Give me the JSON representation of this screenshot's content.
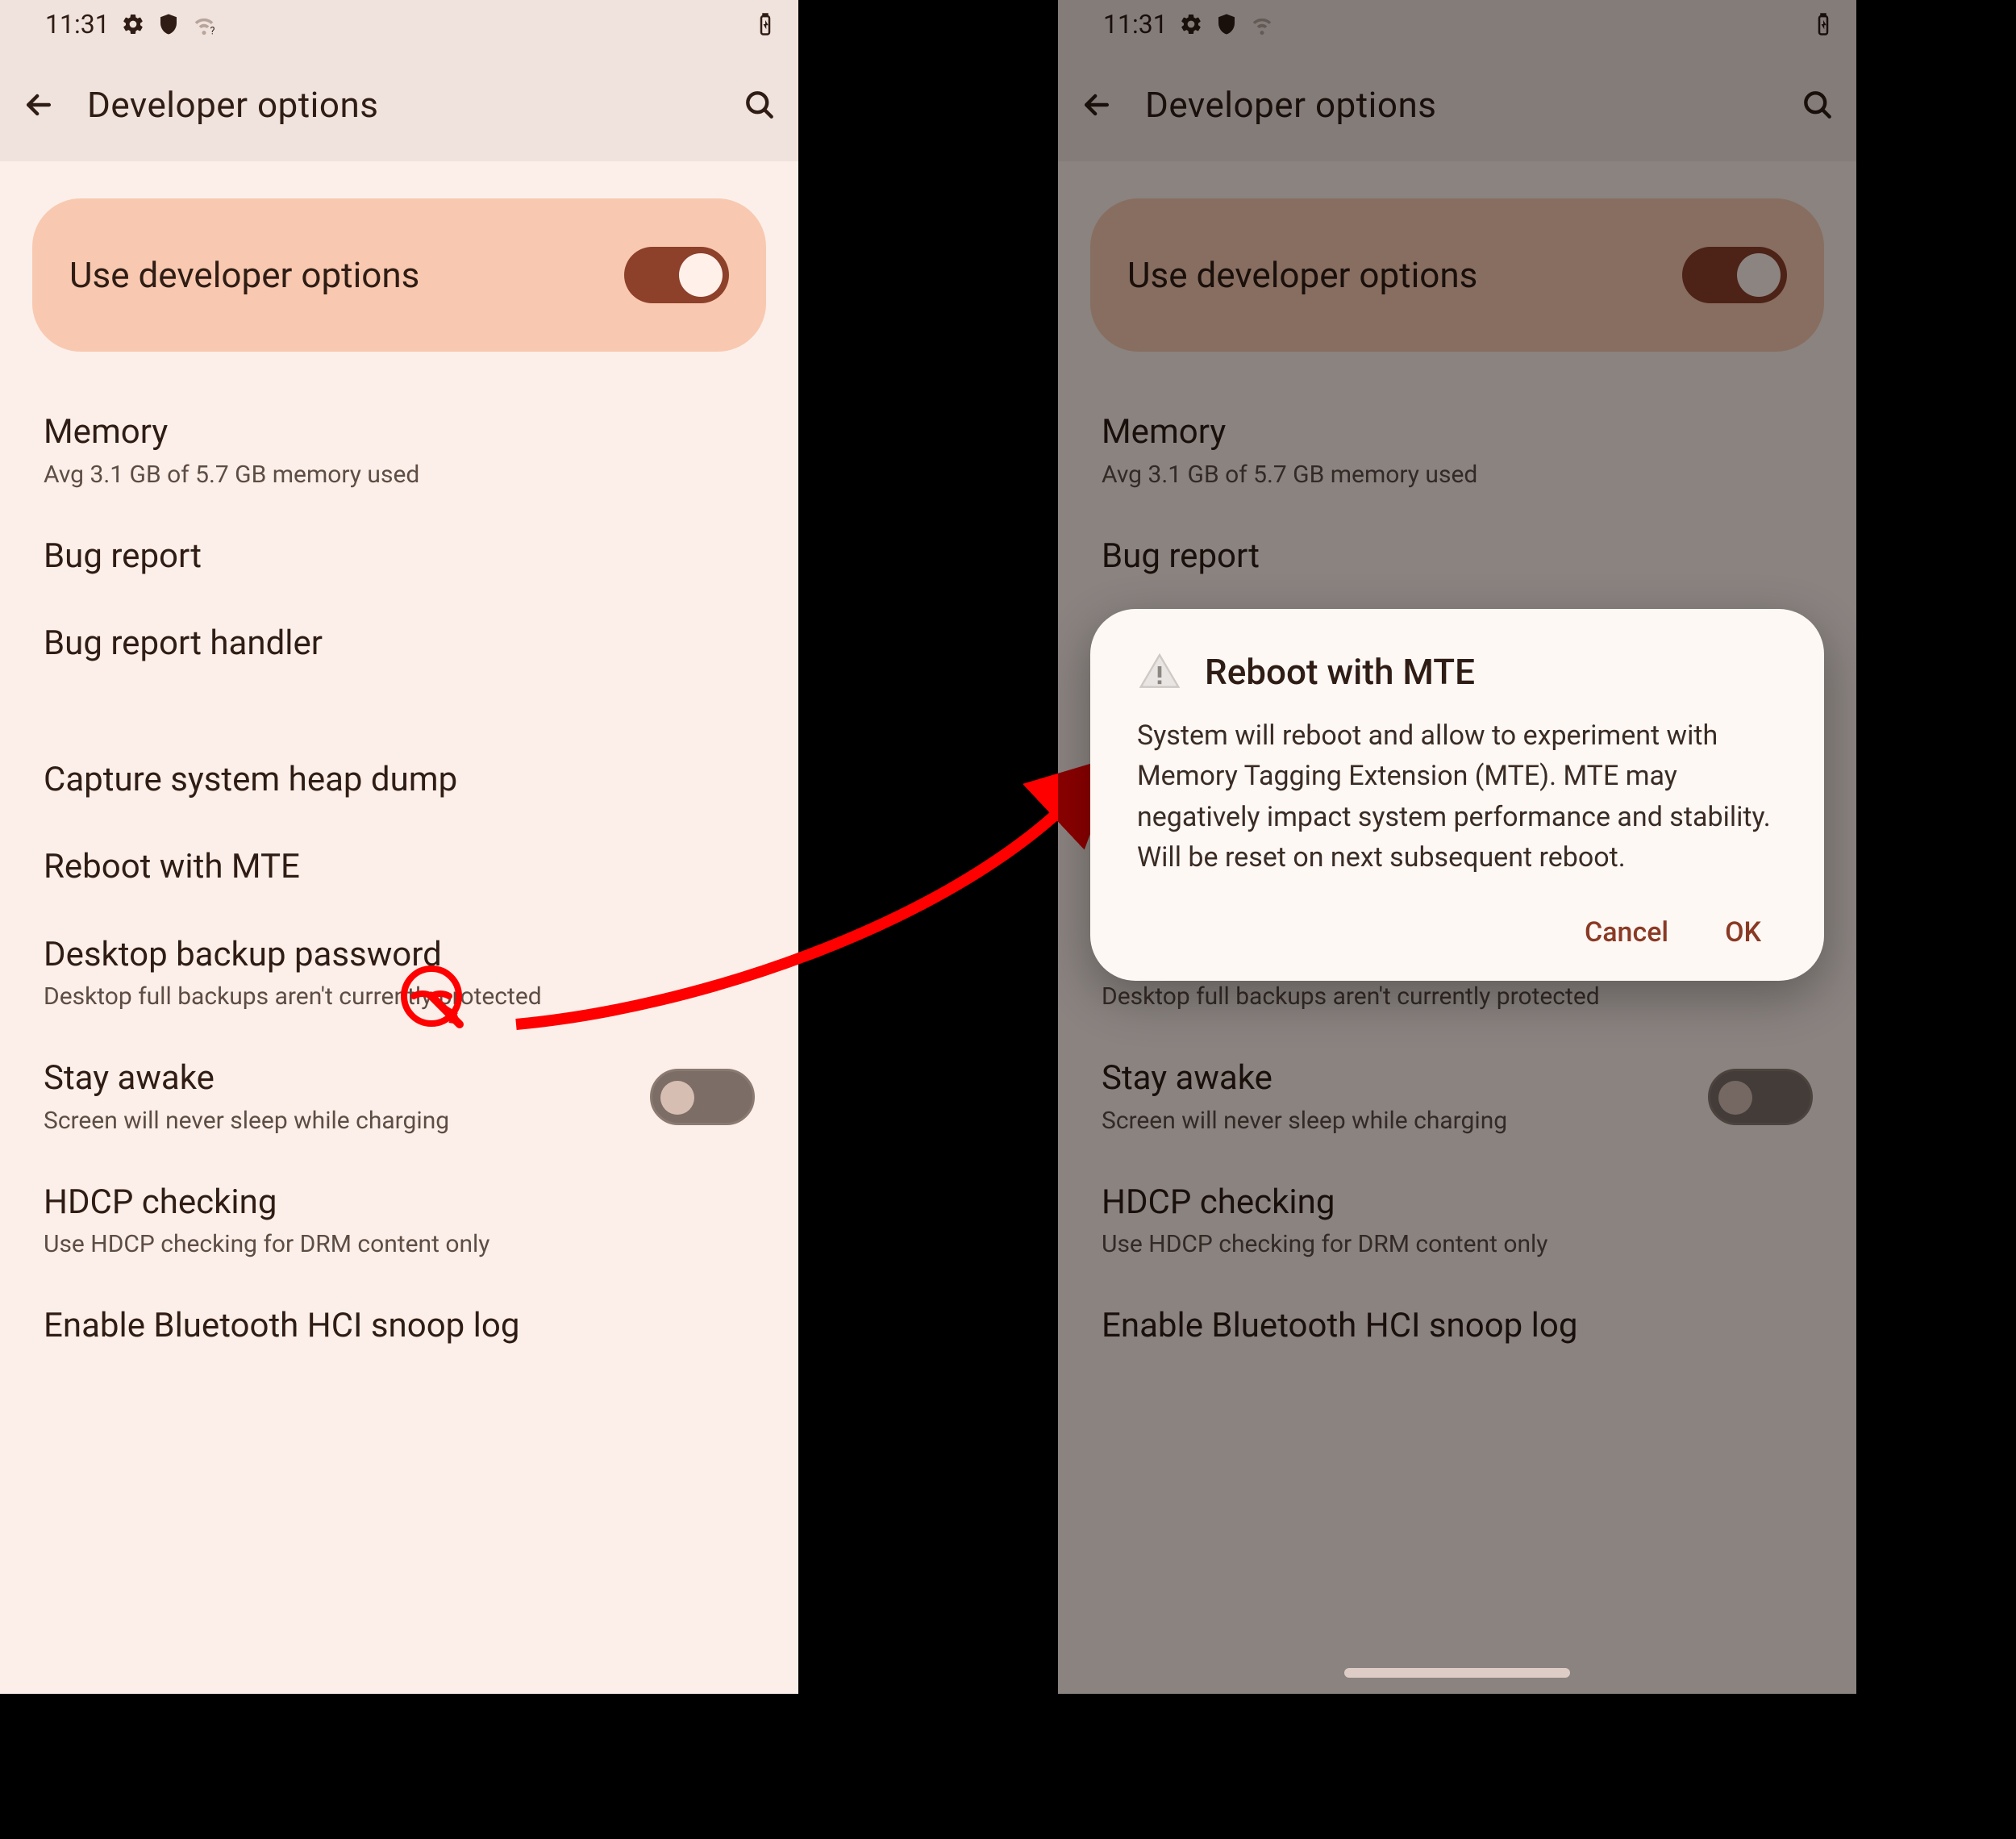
{
  "status": {
    "time": "11:31"
  },
  "header": {
    "title": "Developer options"
  },
  "use_card": {
    "label": "Use developer options",
    "on": true
  },
  "items": {
    "memory": {
      "title": "Memory",
      "sub": "Avg 3.1 GB of 5.7 GB memory used"
    },
    "bugreport": {
      "title": "Bug report"
    },
    "bugreport_handler": {
      "title": "Bug report handler"
    },
    "heap_dump": {
      "title": "Capture system heap dump"
    },
    "reboot_mte": {
      "title": "Reboot with MTE"
    },
    "desktop_backup": {
      "title": "Desktop backup password",
      "sub": "Desktop full backups aren't currently protected"
    },
    "stay_awake": {
      "title": "Stay awake",
      "sub": "Screen will never sleep while charging",
      "on": false
    },
    "hdcp": {
      "title": "HDCP checking",
      "sub": "Use HDCP checking for DRM content only"
    },
    "bt_snoop": {
      "title": "Enable Bluetooth HCI snoop log"
    }
  },
  "dialog": {
    "title": "Reboot with MTE",
    "body": "System will reboot and allow to experiment with Memory Tagging Extension (MTE). MTE may negatively impact system performance and stability. Will be reset on next subsequent reboot.",
    "cancel": "Cancel",
    "ok": "OK"
  }
}
